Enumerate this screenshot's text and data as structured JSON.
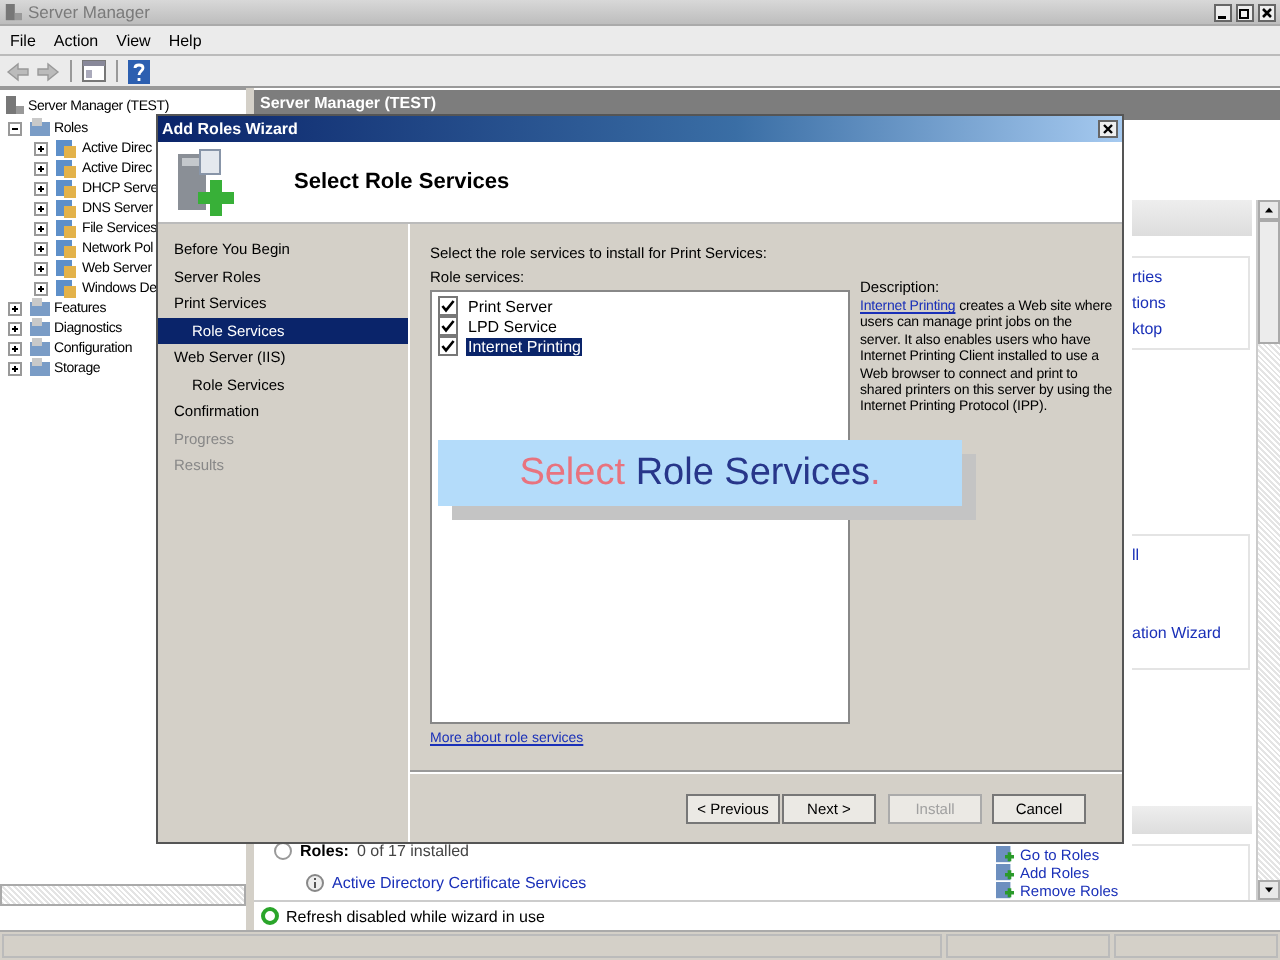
{
  "window": {
    "title": "Server Manager"
  },
  "menu": [
    "File",
    "Action",
    "View",
    "Help"
  ],
  "tree": {
    "label": "Server Manager (TEST)",
    "children": [
      {
        "label": "Roles",
        "expanded": true,
        "children": [
          {
            "label": "Active Direc",
            "expanded": false
          },
          {
            "label": "Active Direc",
            "expanded": false
          },
          {
            "label": "DHCP Serve",
            "expanded": false
          },
          {
            "label": "DNS Server",
            "expanded": false
          },
          {
            "label": "File Services",
            "expanded": false
          },
          {
            "label": "Network Pol",
            "expanded": false
          },
          {
            "label": "Web Server",
            "expanded": false
          },
          {
            "label": "Windows De",
            "expanded": false
          }
        ]
      },
      {
        "label": "Features",
        "expanded": false
      },
      {
        "label": "Diagnostics",
        "expanded": false
      },
      {
        "label": "Configuration",
        "expanded": false
      },
      {
        "label": "Storage",
        "expanded": false
      }
    ]
  },
  "content_header": "Server Manager (TEST)",
  "side_sections": [
    {
      "links": [
        "rties",
        "tions",
        "ktop"
      ]
    },
    {
      "links": [
        "ll",
        "ation Wizard"
      ]
    }
  ],
  "roles_summary": {
    "label": "Roles:",
    "count": "0 of 17 installed"
  },
  "installed_roles": [
    "Active Directory Certificate Services"
  ],
  "role_actions": [
    "Go to Roles",
    "Add Roles",
    "Remove Roles"
  ],
  "status": "Refresh disabled while wizard in use",
  "wizard": {
    "title": "Add Roles Wizard",
    "heading": "Select Role Services",
    "steps": [
      {
        "label": "Before You Begin",
        "selected": false,
        "disabled": false
      },
      {
        "label": "Server Roles",
        "selected": false,
        "disabled": false
      },
      {
        "label": "Print Services",
        "selected": false,
        "disabled": false,
        "children": [
          {
            "label": "Role Services",
            "selected": true,
            "disabled": false
          }
        ]
      },
      {
        "label": "Web Server (IIS)",
        "selected": false,
        "disabled": false,
        "children": [
          {
            "label": "Role Services",
            "selected": false,
            "disabled": false
          }
        ]
      },
      {
        "label": "Confirmation",
        "selected": false,
        "disabled": false
      },
      {
        "label": "Progress",
        "selected": false,
        "disabled": true
      },
      {
        "label": "Results",
        "selected": false,
        "disabled": true
      }
    ],
    "instruction": "Select the role services to install for Print Services:",
    "list_label": "Role services:",
    "services": [
      {
        "label": "Print Server",
        "checked": true,
        "selected": false
      },
      {
        "label": "LPD Service",
        "checked": true,
        "selected": false
      },
      {
        "label": "Internet Printing",
        "checked": true,
        "selected": true
      }
    ],
    "description_label": "Description:",
    "description": {
      "link": "Internet Printing",
      "text": "creates a Web site where users can manage print jobs on the server. It also enables users who have Internet Printing Client installed to use a Web browser to connect and print to shared printers on this server by using the Internet Printing Protocol (IPP)."
    },
    "more_link": "More about role services",
    "buttons": [
      {
        "label": "< Previous",
        "disabled": false
      },
      {
        "label": "Next >",
        "disabled": false
      },
      {
        "label": "Install",
        "disabled": true
      },
      {
        "label": "Cancel",
        "disabled": false
      }
    ]
  },
  "callout": [
    {
      "text": "Select",
      "color": "#e8737e",
      "space_before": false
    },
    {
      "text": "Role Services",
      "color": "#27368a",
      "space_before": true
    },
    {
      "text": ".",
      "color": "#e8737e",
      "space_before": false
    }
  ]
}
